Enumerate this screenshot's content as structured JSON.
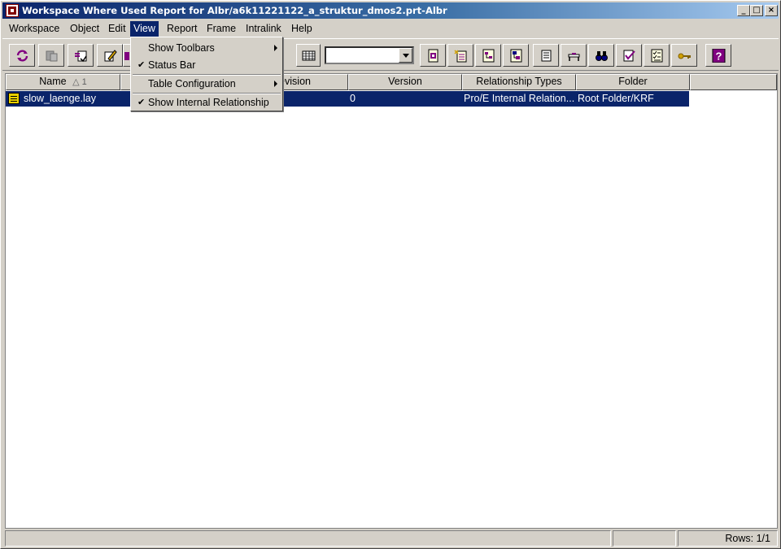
{
  "window": {
    "title": "Workspace Where Used Report for Albr/a6k11221122_a_struktur_dmos2.prt-Albr"
  },
  "menu": {
    "items": [
      "Workspace",
      "Object",
      "Edit",
      "View",
      "Report",
      "Frame",
      "Intralink",
      "Help"
    ],
    "active": "View"
  },
  "view_menu": {
    "show_toolbars": "Show Toolbars",
    "status_bar": "Status Bar",
    "table_configuration": "Table Configuration",
    "show_internal_relationship": "Show Internal Relationship",
    "check": "✔"
  },
  "table": {
    "columns": {
      "name": "Name",
      "sort_indicator": "△ 1",
      "revision": "Revision",
      "version": "Version",
      "relationship_types": "Relationship Types",
      "folder": "Folder"
    },
    "rows": [
      {
        "name": "slow_laenge.lay",
        "version": "0",
        "relationship_types": "Pro/E Internal Relation...",
        "folder": "Root Folder/KRF"
      }
    ]
  },
  "status": {
    "rows": "Rows: 1/1"
  },
  "icons": {
    "toolbar": [
      "refresh-icon",
      "check-in-icon",
      "update-icon",
      "edit-icon",
      "open-icon",
      "table-icon",
      "object-info-icon",
      "new-object-icon",
      "structure-icon",
      "where-used-icon",
      "report-icon",
      "frame-icon",
      "find-icon",
      "verify-icon",
      "checklist-icon",
      "key-icon",
      "help-icon"
    ]
  },
  "colors": {
    "title_bar": "#0a246a",
    "selection": "#0a246a",
    "face": "#d4d0c8",
    "icon_purple": "#800080"
  }
}
